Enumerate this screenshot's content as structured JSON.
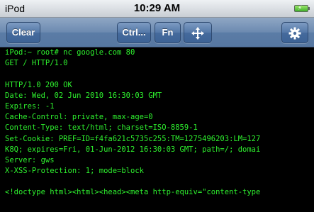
{
  "status_bar": {
    "carrier": "iPod",
    "time": "10:29 AM",
    "battery_icon": "battery-charging-icon",
    "battery_color": "#4cc33a"
  },
  "toolbar": {
    "clear_label": "Clear",
    "ctrl_label": "Ctrl...",
    "fn_label": "Fn",
    "move_icon": "four-way-arrows-icon",
    "settings_icon": "gear-icon",
    "bar_color": "#6c8ab0"
  },
  "terminal": {
    "text_color": "#2ef02e",
    "background": "#000000",
    "lines": [
      "iPod:~ root# nc google.com 80",
      "GET / HTTP/1.0",
      "",
      "HTTP/1.0 200 OK",
      "Date: Wed, 02 Jun 2010 16:30:03 GMT",
      "Expires: -1",
      "Cache-Control: private, max-age=0",
      "Content-Type: text/html; charset=ISO-8859-1",
      "Set-Cookie: PREF=ID=f4fa621c5735c255:TM=1275496203:LM=127",
      "K8Q; expires=Fri, 01-Jun-2012 16:30:03 GMT; path=/; domai",
      "Server: gws",
      "X-XSS-Protection: 1; mode=block",
      "",
      "<!doctype html><html><head><meta http-equiv=\"content-type"
    ]
  }
}
